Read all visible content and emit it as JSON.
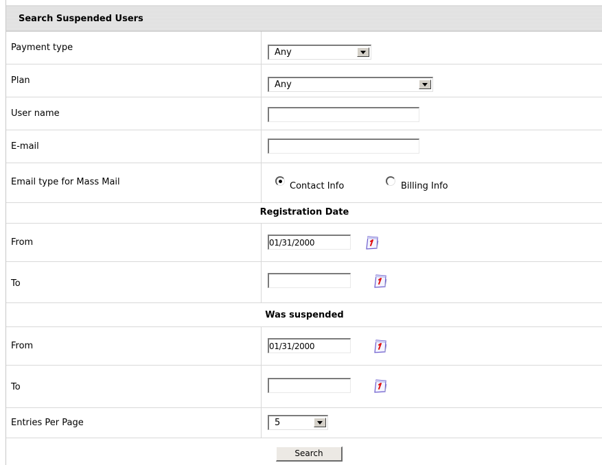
{
  "header": {
    "title": "Search Suspended Users"
  },
  "fields": {
    "payment_type": {
      "label": "Payment type",
      "value": "Any"
    },
    "plan": {
      "label": "Plan",
      "value": "Any"
    },
    "user_name": {
      "label": "User name",
      "value": ""
    },
    "email": {
      "label": "E-mail",
      "value": ""
    },
    "email_type": {
      "label": "Email type for Mass Mail",
      "options": [
        "Contact Info",
        "Billing Info"
      ],
      "selected": "Contact Info"
    }
  },
  "registration_date": {
    "title": "Registration Date",
    "from_label": "From",
    "from_value": "01/31/2000",
    "to_label": "To",
    "to_value": ""
  },
  "was_suspended": {
    "title": "Was suspended",
    "from_label": "From",
    "from_value": "01/31/2000",
    "to_label": "To",
    "to_value": ""
  },
  "entries_per_page": {
    "label": "Entries Per Page",
    "value": "5"
  },
  "search_button": {
    "label": "Search"
  },
  "icons": {
    "calendar": "calendar-icon",
    "dropdown": "chevron-down-icon"
  }
}
